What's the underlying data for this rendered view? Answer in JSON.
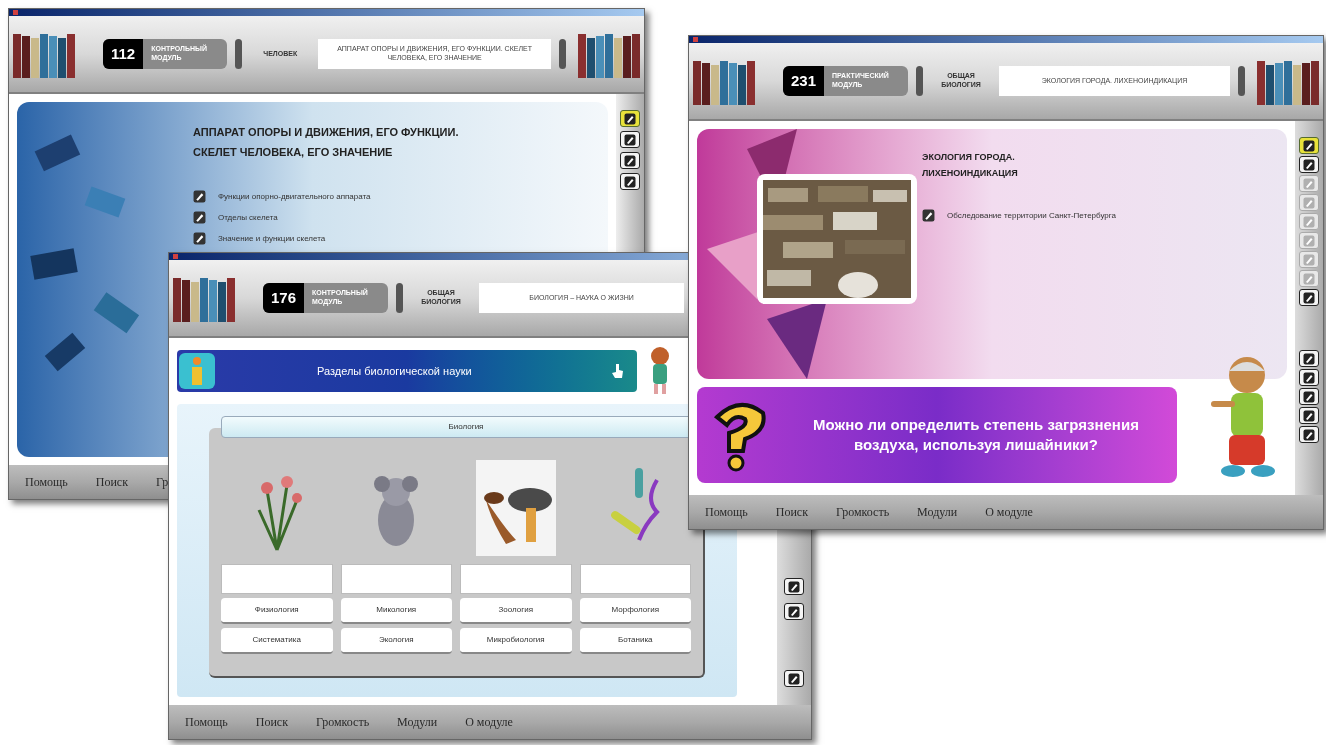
{
  "windows": [
    {
      "kind": "lesson",
      "module": {
        "number": "112",
        "label": "КОНТРОЛЬНЫЙ МОДУЛЬ"
      },
      "subject": "ЧЕЛОВЕК",
      "topic": "АППАРАТ ОПОРЫ И ДВИЖЕНИЯ, ЕГО ФУНКЦИИ. СКЕЛЕТ ЧЕЛОВЕКА, ЕГО ЗНАЧЕНИЕ",
      "heading": "АППАРАТ ОПОРЫ И ДВИЖЕНИЯ, ЕГО ФУНКЦИИ. СКЕЛЕТ ЧЕЛОВЕКА, ЕГО ЗНАЧЕНИЕ",
      "items": [
        "Функции опорно-двигательного аппарата",
        "Отделы скелета",
        "Значение и функции скелета"
      ],
      "sidebar": [
        {
          "selected": true,
          "disabled": false
        },
        {
          "selected": false,
          "disabled": false
        },
        {
          "selected": false,
          "disabled": false
        },
        {
          "selected": false,
          "disabled": false
        }
      ],
      "menu": [
        "Помощь",
        "Поиск",
        "Гр"
      ]
    },
    {
      "kind": "exercise",
      "module": {
        "number": "176",
        "label": "КОНТРОЛЬНЫЙ МОДУЛЬ"
      },
      "subject": "ОБЩАЯ БИОЛОГИЯ",
      "topic": "БИОЛОГИЯ – НАУКА О ЖИЗНИ",
      "banner": "Разделы биологической науки",
      "group": "Биология",
      "cards": [
        {
          "kind": "picture"
        },
        {
          "kind": "picture"
        },
        {
          "kind": "picture"
        },
        {
          "kind": "picture"
        }
      ],
      "options": [
        "Физиология",
        "Микология",
        "Зоология",
        "Морфология",
        "Систематика",
        "Экология",
        "Микробиология",
        "Ботаника"
      ],
      "sidebar": [
        {
          "selected": false,
          "disabled": false
        },
        {
          "selected": false,
          "disabled": false
        },
        {
          "selected": false,
          "disabled": false
        }
      ],
      "menu": [
        "Помощь",
        "Поиск",
        "Громкость",
        "Модули",
        "О модуле"
      ]
    },
    {
      "kind": "practice",
      "module": {
        "number": "231",
        "label": "ПРАКТИЧЕСКИЙ МОДУЛЬ"
      },
      "subject": "ОБЩАЯ БИОЛОГИЯ",
      "topic": "ЭКОЛОГИЯ ГОРОДА. ЛИХЕНОИНДИКАЦИЯ",
      "heading": "ЭКОЛОГИЯ ГОРОДА. ЛИХЕНОИНДИКАЦИЯ",
      "items": [
        "Обследование территории Санкт-Петербурга"
      ],
      "question": "Можно ли определить степень загрязнения воздуха, используя лишайники?",
      "sidebar": [
        {
          "selected": true,
          "disabled": false
        },
        {
          "selected": false,
          "disabled": false
        },
        {
          "selected": false,
          "disabled": true
        },
        {
          "selected": false,
          "disabled": true
        },
        {
          "selected": false,
          "disabled": true
        },
        {
          "selected": false,
          "disabled": true
        },
        {
          "selected": false,
          "disabled": true
        },
        {
          "selected": false,
          "disabled": true
        },
        {
          "selected": false,
          "disabled": false
        },
        {
          "selected": false,
          "disabled": false
        },
        {
          "selected": false,
          "disabled": false
        },
        {
          "selected": false,
          "disabled": false
        },
        {
          "selected": false,
          "disabled": false
        },
        {
          "selected": false,
          "disabled": false
        }
      ],
      "menu": [
        "Помощь",
        "Поиск",
        "Громкость",
        "Модули",
        "О модуле"
      ]
    }
  ]
}
